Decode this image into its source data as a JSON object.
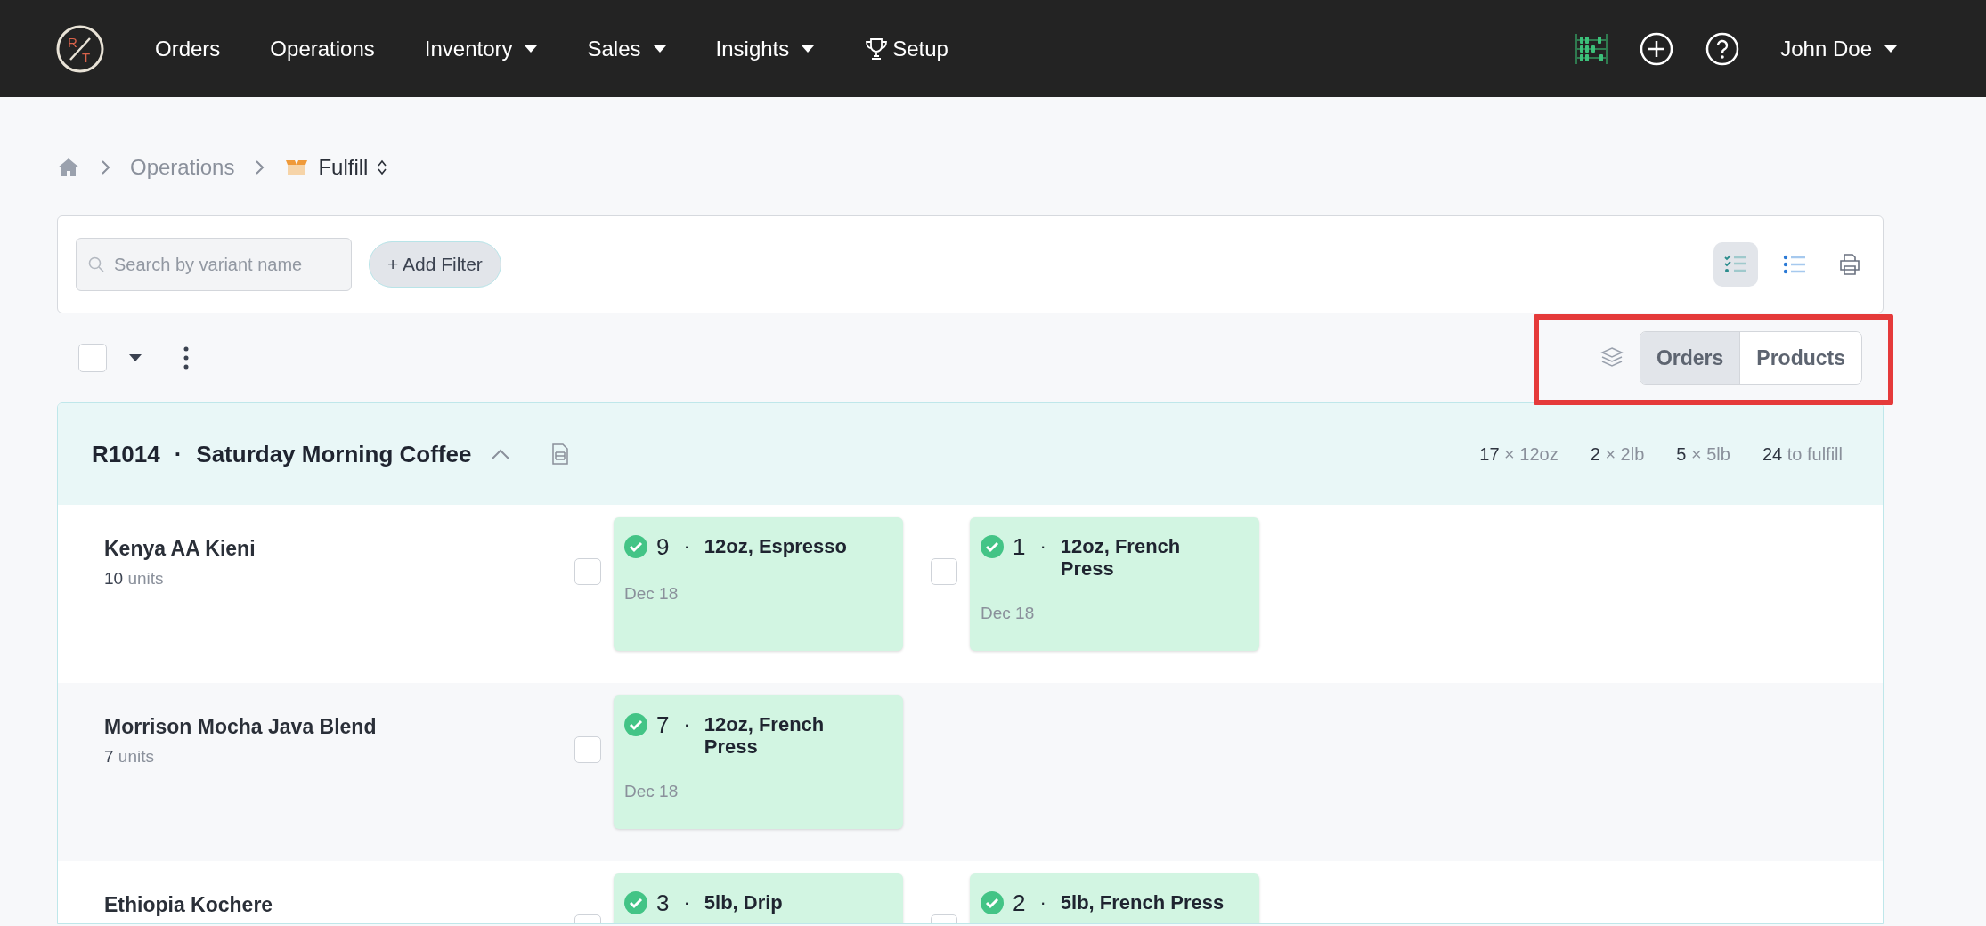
{
  "nav": {
    "logo": {
      "letters": [
        "R",
        "T"
      ]
    },
    "items": [
      {
        "label": "Orders",
        "kind": "link"
      },
      {
        "label": "Operations",
        "kind": "link"
      },
      {
        "label": "Inventory",
        "kind": "dropdown"
      },
      {
        "label": "Sales",
        "kind": "dropdown"
      },
      {
        "label": "Insights",
        "kind": "dropdown"
      },
      {
        "label": "Setup",
        "kind": "trophy"
      }
    ],
    "user": "John Doe"
  },
  "breadcrumb": [
    "Operations",
    "Fulfill"
  ],
  "search": {
    "placeholder": "Search by variant name"
  },
  "add_filter": "+ Add Filter",
  "view_toggles": [
    {
      "kind": "checklist",
      "selected": true
    },
    {
      "kind": "list",
      "selected": false
    }
  ],
  "select_all": {
    "checked": false
  },
  "group_by": {
    "highlighted": true,
    "options": [
      {
        "label": "Orders",
        "selected": true
      },
      {
        "label": "Products",
        "selected": false
      }
    ]
  },
  "order": {
    "number": "R1014",
    "separator": "·",
    "name": "Saturday Morning Coffee",
    "expanded": true,
    "stats": [
      {
        "count": "17",
        "label": "× 12oz"
      },
      {
        "count": "2",
        "label": "× 2lb"
      },
      {
        "count": "5",
        "label": "× 5lb"
      },
      {
        "count": "24",
        "label": "to fulfill"
      }
    ],
    "products": [
      {
        "name": "Kenya AA Kieni",
        "units_count": "10",
        "units_label": "units",
        "items": [
          {
            "checked": false,
            "done": true,
            "quantity": "9",
            "separator": "·",
            "variant": "12oz, Espresso",
            "date": "Dec 18"
          },
          {
            "checked": false,
            "done": true,
            "quantity": "1",
            "separator": "·",
            "variant": "12oz, French Press",
            "date": "Dec 18"
          }
        ]
      },
      {
        "name": "Morrison Mocha Java Blend",
        "units_count": "7",
        "units_label": "units",
        "items": [
          {
            "checked": false,
            "done": true,
            "quantity": "7",
            "separator": "·",
            "variant": "12oz, French Press",
            "date": "Dec 18"
          }
        ]
      },
      {
        "name": "Ethiopia Kochere",
        "items": [
          {
            "checked": false,
            "done": true,
            "quantity": "3",
            "separator": "·",
            "variant": "5lb, Drip"
          },
          {
            "checked": false,
            "done": true,
            "quantity": "2",
            "separator": "·",
            "variant": "5lb, French Press"
          }
        ]
      }
    ]
  }
}
